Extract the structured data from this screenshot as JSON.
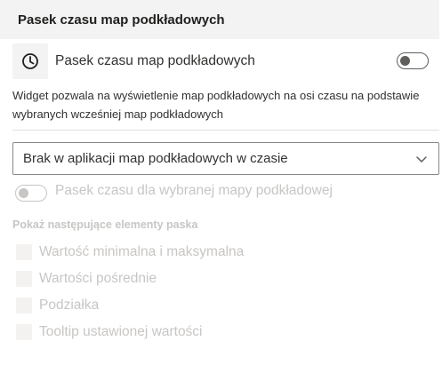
{
  "header": {
    "title": "Pasek czasu map podkładowych"
  },
  "main_toggle": {
    "label": "Pasek czasu map podkładowych",
    "enabled": false,
    "icon": "clock-icon"
  },
  "description": "Widget pozwala na wyświetlenie map podkładowych na osi czasu na podstawie wybranych wcześniej map podkładowych",
  "dropdown": {
    "value": "Brak w aplikacji map podkładowych w czasie",
    "icon": "chevron-down-icon"
  },
  "selected_map_toggle": {
    "label": "Pasek czasu dla wybranej mapy podkładowej",
    "enabled": false,
    "disabled": true
  },
  "elements_section": {
    "title": "Pokaż następujące elementy paska",
    "checkboxes": [
      {
        "label": "Wartość minimalna i maksymalna",
        "checked": false,
        "disabled": true
      },
      {
        "label": "Wartości pośrednie",
        "checked": false,
        "disabled": true
      },
      {
        "label": "Podziałka",
        "checked": false,
        "disabled": true
      },
      {
        "label": "Tooltip ustawionej wartości",
        "checked": false,
        "disabled": true
      }
    ]
  },
  "colors": {
    "header_bg": "#f3f3f3",
    "text": "#323130",
    "disabled": "#c8c6c4",
    "toggle_off": "#605e5c"
  }
}
